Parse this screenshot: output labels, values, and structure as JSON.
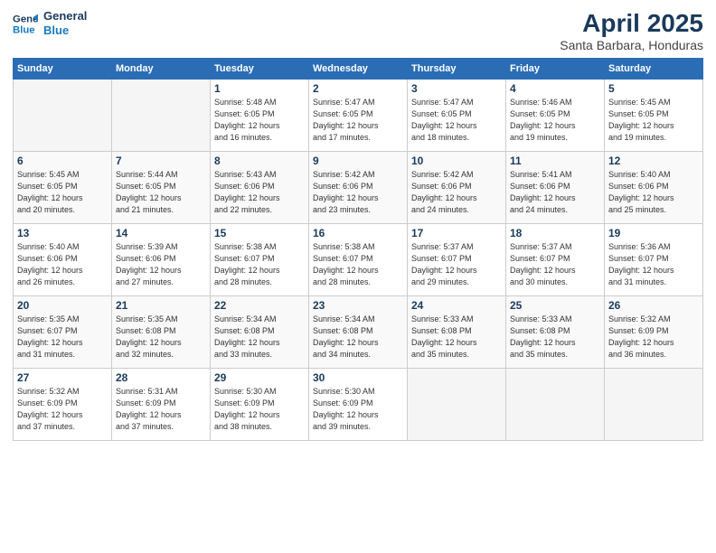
{
  "header": {
    "logo_line1": "General",
    "logo_line2": "Blue",
    "month": "April 2025",
    "location": "Santa Barbara, Honduras"
  },
  "weekdays": [
    "Sunday",
    "Monday",
    "Tuesday",
    "Wednesday",
    "Thursday",
    "Friday",
    "Saturday"
  ],
  "weeks": [
    [
      {
        "day": "",
        "info": ""
      },
      {
        "day": "",
        "info": ""
      },
      {
        "day": "1",
        "info": "Sunrise: 5:48 AM\nSunset: 6:05 PM\nDaylight: 12 hours\nand 16 minutes."
      },
      {
        "day": "2",
        "info": "Sunrise: 5:47 AM\nSunset: 6:05 PM\nDaylight: 12 hours\nand 17 minutes."
      },
      {
        "day": "3",
        "info": "Sunrise: 5:47 AM\nSunset: 6:05 PM\nDaylight: 12 hours\nand 18 minutes."
      },
      {
        "day": "4",
        "info": "Sunrise: 5:46 AM\nSunset: 6:05 PM\nDaylight: 12 hours\nand 19 minutes."
      },
      {
        "day": "5",
        "info": "Sunrise: 5:45 AM\nSunset: 6:05 PM\nDaylight: 12 hours\nand 19 minutes."
      }
    ],
    [
      {
        "day": "6",
        "info": "Sunrise: 5:45 AM\nSunset: 6:05 PM\nDaylight: 12 hours\nand 20 minutes."
      },
      {
        "day": "7",
        "info": "Sunrise: 5:44 AM\nSunset: 6:05 PM\nDaylight: 12 hours\nand 21 minutes."
      },
      {
        "day": "8",
        "info": "Sunrise: 5:43 AM\nSunset: 6:06 PM\nDaylight: 12 hours\nand 22 minutes."
      },
      {
        "day": "9",
        "info": "Sunrise: 5:42 AM\nSunset: 6:06 PM\nDaylight: 12 hours\nand 23 minutes."
      },
      {
        "day": "10",
        "info": "Sunrise: 5:42 AM\nSunset: 6:06 PM\nDaylight: 12 hours\nand 24 minutes."
      },
      {
        "day": "11",
        "info": "Sunrise: 5:41 AM\nSunset: 6:06 PM\nDaylight: 12 hours\nand 24 minutes."
      },
      {
        "day": "12",
        "info": "Sunrise: 5:40 AM\nSunset: 6:06 PM\nDaylight: 12 hours\nand 25 minutes."
      }
    ],
    [
      {
        "day": "13",
        "info": "Sunrise: 5:40 AM\nSunset: 6:06 PM\nDaylight: 12 hours\nand 26 minutes."
      },
      {
        "day": "14",
        "info": "Sunrise: 5:39 AM\nSunset: 6:06 PM\nDaylight: 12 hours\nand 27 minutes."
      },
      {
        "day": "15",
        "info": "Sunrise: 5:38 AM\nSunset: 6:07 PM\nDaylight: 12 hours\nand 28 minutes."
      },
      {
        "day": "16",
        "info": "Sunrise: 5:38 AM\nSunset: 6:07 PM\nDaylight: 12 hours\nand 28 minutes."
      },
      {
        "day": "17",
        "info": "Sunrise: 5:37 AM\nSunset: 6:07 PM\nDaylight: 12 hours\nand 29 minutes."
      },
      {
        "day": "18",
        "info": "Sunrise: 5:37 AM\nSunset: 6:07 PM\nDaylight: 12 hours\nand 30 minutes."
      },
      {
        "day": "19",
        "info": "Sunrise: 5:36 AM\nSunset: 6:07 PM\nDaylight: 12 hours\nand 31 minutes."
      }
    ],
    [
      {
        "day": "20",
        "info": "Sunrise: 5:35 AM\nSunset: 6:07 PM\nDaylight: 12 hours\nand 31 minutes."
      },
      {
        "day": "21",
        "info": "Sunrise: 5:35 AM\nSunset: 6:08 PM\nDaylight: 12 hours\nand 32 minutes."
      },
      {
        "day": "22",
        "info": "Sunrise: 5:34 AM\nSunset: 6:08 PM\nDaylight: 12 hours\nand 33 minutes."
      },
      {
        "day": "23",
        "info": "Sunrise: 5:34 AM\nSunset: 6:08 PM\nDaylight: 12 hours\nand 34 minutes."
      },
      {
        "day": "24",
        "info": "Sunrise: 5:33 AM\nSunset: 6:08 PM\nDaylight: 12 hours\nand 35 minutes."
      },
      {
        "day": "25",
        "info": "Sunrise: 5:33 AM\nSunset: 6:08 PM\nDaylight: 12 hours\nand 35 minutes."
      },
      {
        "day": "26",
        "info": "Sunrise: 5:32 AM\nSunset: 6:09 PM\nDaylight: 12 hours\nand 36 minutes."
      }
    ],
    [
      {
        "day": "27",
        "info": "Sunrise: 5:32 AM\nSunset: 6:09 PM\nDaylight: 12 hours\nand 37 minutes."
      },
      {
        "day": "28",
        "info": "Sunrise: 5:31 AM\nSunset: 6:09 PM\nDaylight: 12 hours\nand 37 minutes."
      },
      {
        "day": "29",
        "info": "Sunrise: 5:30 AM\nSunset: 6:09 PM\nDaylight: 12 hours\nand 38 minutes."
      },
      {
        "day": "30",
        "info": "Sunrise: 5:30 AM\nSunset: 6:09 PM\nDaylight: 12 hours\nand 39 minutes."
      },
      {
        "day": "",
        "info": ""
      },
      {
        "day": "",
        "info": ""
      },
      {
        "day": "",
        "info": ""
      }
    ]
  ]
}
